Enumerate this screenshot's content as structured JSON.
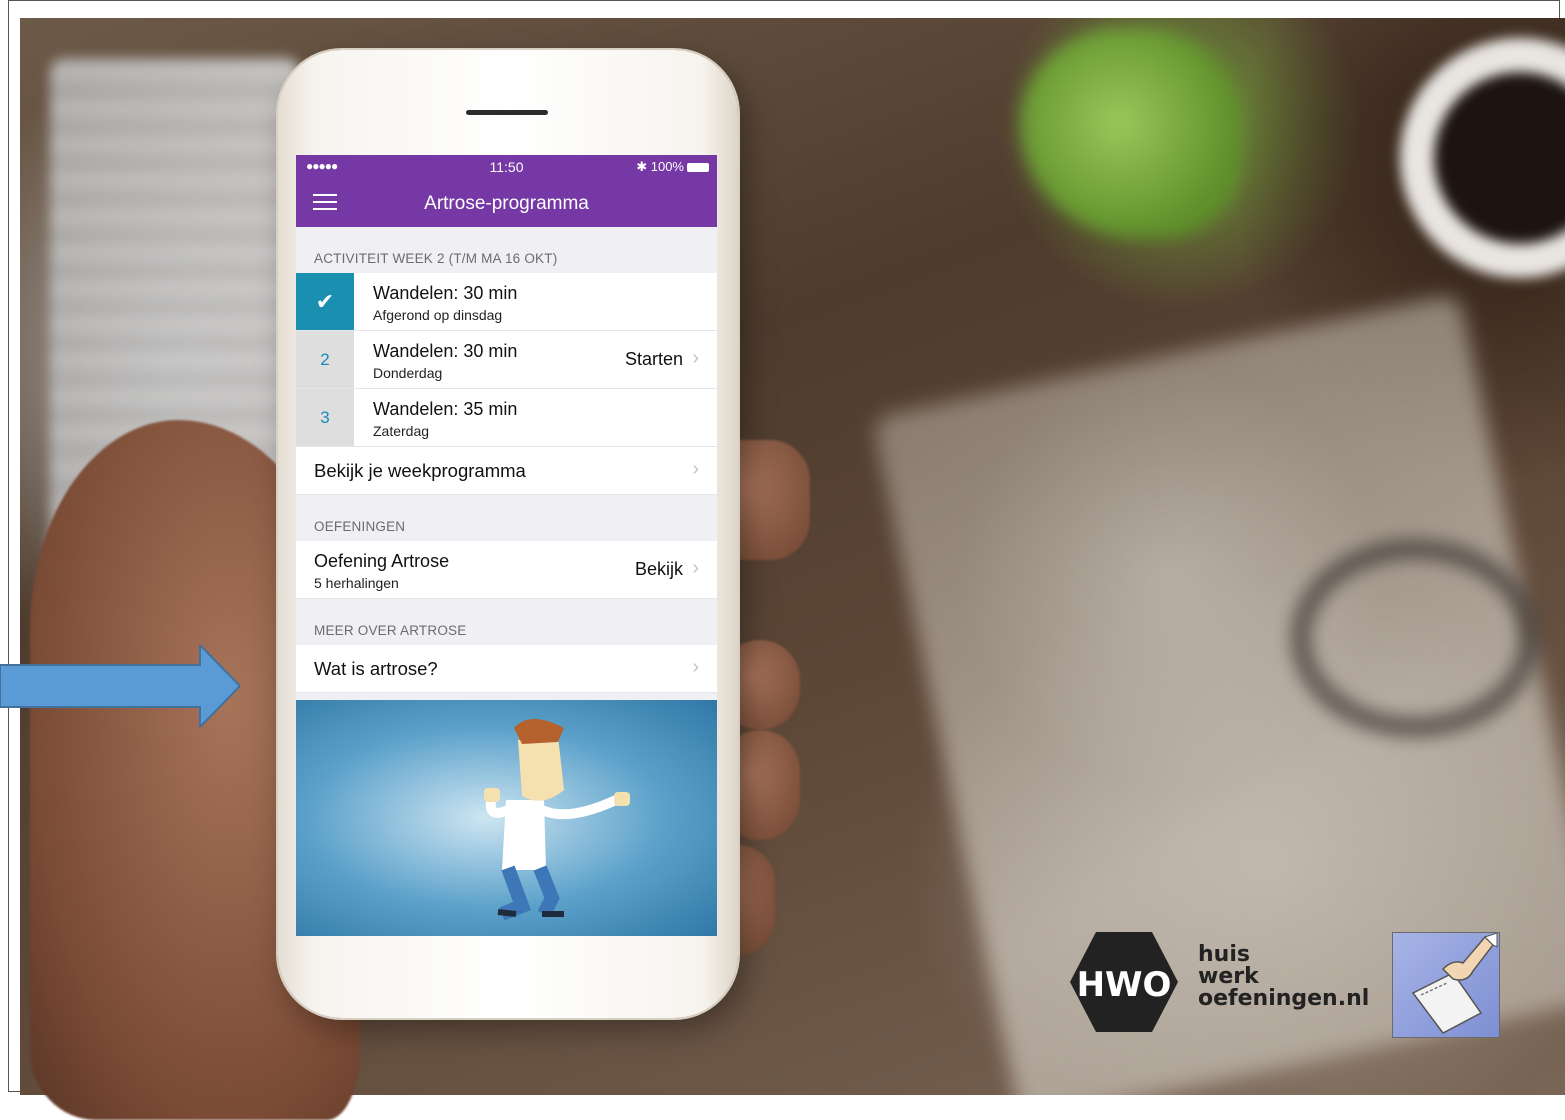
{
  "status_bar": {
    "signal": "●●●●● ",
    "time": "11:50",
    "battery": "✱ 100%"
  },
  "app": {
    "title": "Artrose-programma"
  },
  "activity": {
    "header": "ACTIVITEIT WEEK 2 (T/M MA 16 OKT)",
    "items": [
      {
        "badge": "✔",
        "title": "Wandelen: 30 min",
        "subtitle": "Afgerond op dinsdag",
        "action": ""
      },
      {
        "badge": "2",
        "title": "Wandelen: 30 min",
        "subtitle": "Donderdag",
        "action": "Starten"
      },
      {
        "badge": "3",
        "title": "Wandelen: 35 min",
        "subtitle": "Zaterdag",
        "action": ""
      }
    ],
    "week_link": "Bekijk je weekprogramma"
  },
  "exercises": {
    "header": "OEFENINGEN",
    "item": {
      "title": "Oefening Artrose",
      "subtitle": "5 herhalingen",
      "action": "Bekijk"
    }
  },
  "more": {
    "header": "MEER OVER ARTROSE",
    "link": "Wat is artrose?"
  },
  "branding": {
    "hex_text": "HWO",
    "line1": "huis",
    "line2": "werk",
    "line3": "oefeningen.nl"
  },
  "colors": {
    "app_purple": "#7638a5",
    "done_badge": "#1a8fb0",
    "arrow_blue": "#5b9bd5"
  },
  "icons": {
    "menu": "hamburger-icon",
    "chevron": "chevron-right-icon",
    "check": "check-icon"
  }
}
